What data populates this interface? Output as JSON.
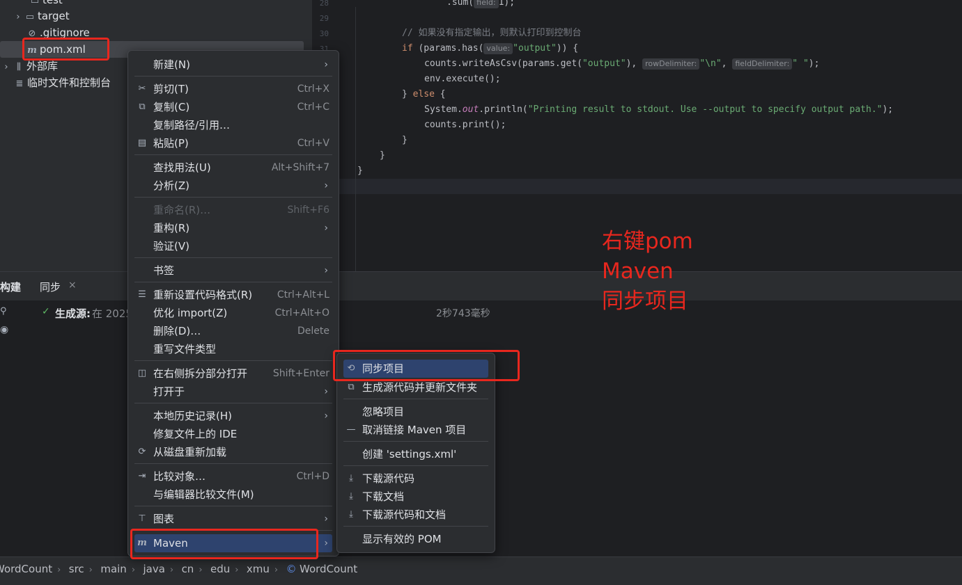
{
  "project_tree": {
    "items": [
      {
        "label": "test",
        "icon": "folder-icon"
      },
      {
        "label": "target",
        "icon": "folder-icon"
      },
      {
        "label": ".gitignore",
        "icon": "ignore-file-icon"
      },
      {
        "label": "pom.xml",
        "icon": "maven-file-icon"
      },
      {
        "label": "外部库",
        "icon": "library-icon"
      },
      {
        "label": "临时文件和控制台",
        "icon": "scratch-icon"
      }
    ]
  },
  "editor": {
    "line_numbers": [
      "28",
      "29",
      "30",
      "31"
    ],
    "hints": {
      "field": "field:",
      "value": "value:",
      "row_delimiter": "rowDelimiter:",
      "field_delimiter": "fieldDelimiter:"
    },
    "code": {
      "l28a": ".sum(",
      "l28b": "1);",
      "l30": "// 如果没有指定输出，则默认打印到控制台",
      "l31_if": "if",
      "l31a": " (params.has(",
      "l31_str": "\"output\"",
      "l31b": ")) {",
      "l32a": "counts.writeAsCsv(params.get(",
      "l32_str": "\"output\"",
      "l32b": "), ",
      "l32_nl": "\"\\n\"",
      "l32c": ", ",
      "l32_sp": "\" \"",
      "l32d": ");",
      "l33": "env.execute();",
      "l34a": "} ",
      "l34_else": "else",
      "l34b": " {",
      "l35a": "System.",
      "l35_out": "out",
      "l35b": ".println(",
      "l35_str": "\"Printing result to stdout. Use --output to specify output path.\"",
      "l35c": ");",
      "l36": "counts.print();",
      "l37": "}",
      "l38": "}",
      "l39": "}"
    }
  },
  "bottom_panel": {
    "tabs": [
      {
        "label": "构建"
      },
      {
        "label": "同步"
      }
    ],
    "close_glyph": "×",
    "build_status_label": "生成源:",
    "build_status_text": "在 2025",
    "duration": "2秒743毫秒"
  },
  "context_menu": {
    "items": [
      {
        "label": "新建(N)",
        "submenu": true
      },
      {
        "label": "剪切(T)",
        "shortcut": "Ctrl+X",
        "icon": "cut-icon"
      },
      {
        "label": "复制(C)",
        "shortcut": "Ctrl+C",
        "icon": "copy-icon"
      },
      {
        "label": "复制路径/引用…"
      },
      {
        "label": "粘贴(P)",
        "shortcut": "Ctrl+V",
        "icon": "paste-icon"
      },
      {
        "label": "查找用法(U)",
        "shortcut": "Alt+Shift+7"
      },
      {
        "label": "分析(Z)",
        "submenu": true
      },
      {
        "label": "重命名(R)…",
        "shortcut": "Shift+F6",
        "disabled": true
      },
      {
        "label": "重构(R)",
        "submenu": true
      },
      {
        "label": "验证(V)"
      },
      {
        "label": "书签",
        "submenu": true
      },
      {
        "label": "重新设置代码格式(R)",
        "shortcut": "Ctrl+Alt+L",
        "icon": "reformat-icon"
      },
      {
        "label": "优化 import(Z)",
        "shortcut": "Ctrl+Alt+O"
      },
      {
        "label": "删除(D)…",
        "shortcut": "Delete"
      },
      {
        "label": "重写文件类型"
      },
      {
        "label": "在右侧拆分部分打开",
        "shortcut": "Shift+Enter",
        "icon": "split-icon"
      },
      {
        "label": "打开于",
        "submenu": true
      },
      {
        "label": "本地历史记录(H)",
        "submenu": true
      },
      {
        "label": "修复文件上的 IDE"
      },
      {
        "label": "从磁盘重新加载",
        "icon": "reload-icon"
      },
      {
        "label": "比较对象…",
        "shortcut": "Ctrl+D",
        "icon": "compare-icon"
      },
      {
        "label": "与编辑器比较文件(M)"
      },
      {
        "label": "图表",
        "submenu": true,
        "icon": "diagram-icon"
      },
      {
        "label": "Maven",
        "submenu": true,
        "icon": "maven-icon",
        "selected": true
      }
    ],
    "arrow_glyph": "›"
  },
  "maven_submenu": {
    "items": [
      {
        "label": "同步项目",
        "icon": "sync-icon",
        "selected": true
      },
      {
        "label": "生成源代码并更新文件夹",
        "icon": "generate-sources-icon"
      },
      {
        "label": "忽略项目"
      },
      {
        "label": "取消链接 Maven 项目",
        "icon": "minus-icon"
      },
      {
        "label": "创建 'settings.xml'"
      },
      {
        "label": "下载源代码",
        "icon": "download-icon"
      },
      {
        "label": "下载文档",
        "icon": "download-icon"
      },
      {
        "label": "下载源代码和文档",
        "icon": "download-icon"
      },
      {
        "label": "显示有效的 POM"
      }
    ]
  },
  "breadcrumbs": [
    "WordCount",
    "src",
    "main",
    "java",
    "cn",
    "edu",
    "xmu",
    "WordCount"
  ],
  "annotation": {
    "lines": [
      "右键pom",
      "Maven",
      "同步项目"
    ],
    "color": "#e8271e"
  }
}
